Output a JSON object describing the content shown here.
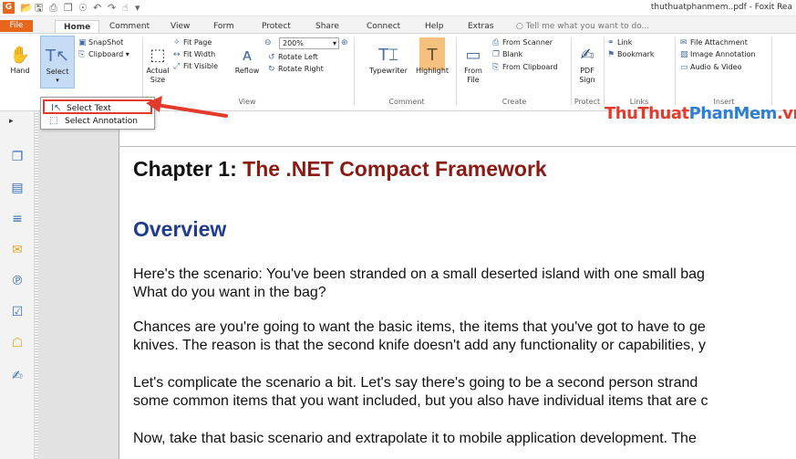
{
  "titlebar": {
    "logo": "G",
    "title": "thuthuatphanmem..pdf - Foxit Rea"
  },
  "menu": {
    "file": "File",
    "tabs": [
      "Home",
      "Comment",
      "View",
      "Form",
      "Protect",
      "Share",
      "Connect",
      "Help",
      "Extras"
    ],
    "tell_me": "Tell me what you want to do..."
  },
  "ribbon": {
    "tools": {
      "hand": "Hand",
      "select": "Select",
      "snapshot": "SnapShot",
      "clipboard": "Clipboard",
      "actual_size_1": "Actual",
      "actual_size_2": "Size",
      "fit_page": "Fit Page",
      "fit_width": "Fit Width",
      "fit_visible": "Fit Visible",
      "reflow": "Reflow",
      "zoom_value": "200%",
      "rotate_left": "Rotate Left",
      "rotate_right": "Rotate Right"
    },
    "comment": {
      "typewriter": "Typewriter",
      "highlight": "Highlight"
    },
    "create": {
      "from_file_1": "From",
      "from_file_2": "File",
      "from_scanner": "From Scanner",
      "blank": "Blank",
      "from_clipboard": "From Clipboard"
    },
    "protect": {
      "pdf_sign_1": "PDF",
      "pdf_sign_2": "Sign"
    },
    "links": {
      "link": "Link",
      "bookmark": "Bookmark"
    },
    "insert": {
      "file_attachment": "File Attachment",
      "image_annotation": "Image Annotation",
      "audio_video": "Audio & Video"
    },
    "group_labels": {
      "view": "View",
      "comment": "Comment",
      "create": "Create",
      "protect": "Protect",
      "links": "Links",
      "insert": "Insert"
    }
  },
  "dropdown": {
    "select_text": "Select Text",
    "select_annotation": "Select Annotation"
  },
  "watermark": {
    "part1": "ThuThuat",
    "part2": "PhanMem",
    "part3": ".vn"
  },
  "document": {
    "chapter_prefix": "Chapter 1: ",
    "chapter_title": "The .NET Compact Framework",
    "heading": "Overview",
    "paragraphs": [
      [
        "Here's the scenario: You've been stranded on a small deserted island with one small bag",
        "What do you want in the bag?"
      ],
      [
        "Chances are you're going to want the basic items, the items that you've got to have to ge",
        "knives. The reason is that the second knife doesn't add any functionality or capabilities, y"
      ],
      [
        "Let's complicate the scenario a bit. Let's say there's going to be a second person strand",
        "some common items that you want included, but you also have individual items that are c"
      ],
      [
        "Now, take that basic scenario and extrapolate it to mobile application development. The"
      ]
    ]
  },
  "colors": {
    "accent": "#e8651c",
    "chapter_red": "#8b1a14",
    "heading_blue": "#1f3c91",
    "callout_red": "#e23b2c"
  }
}
